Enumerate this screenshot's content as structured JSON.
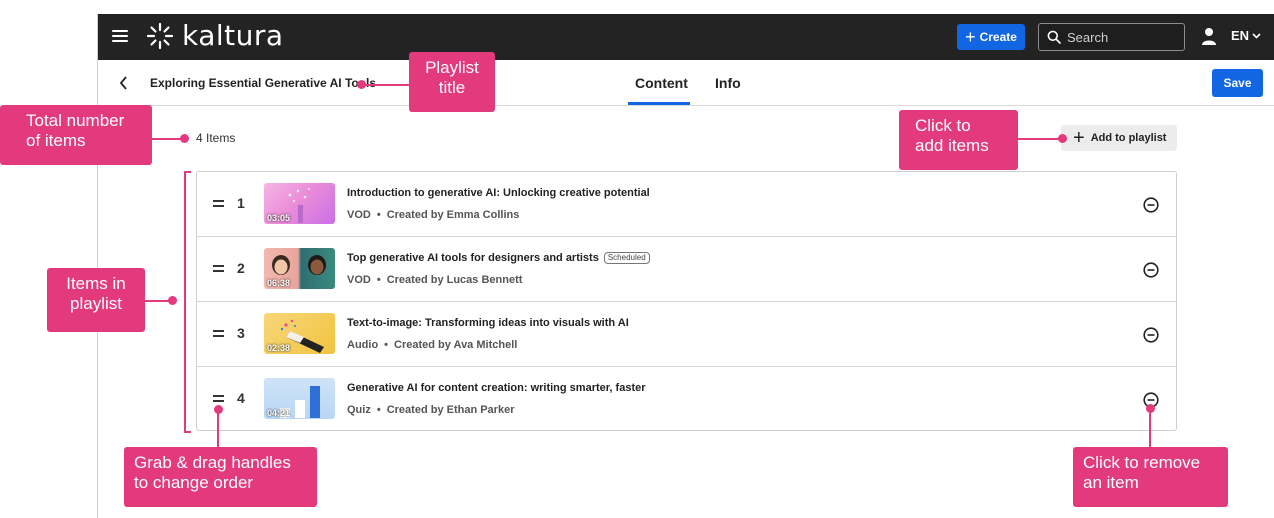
{
  "app": {
    "logo_text": "kaltura",
    "create_label": "Create",
    "search_placeholder": "Search",
    "language": "EN"
  },
  "header": {
    "playlist_title": "Exploring Essential Generative AI Tools",
    "tabs": [
      {
        "label": "Content",
        "active": true
      },
      {
        "label": "Info",
        "active": false
      }
    ],
    "save_label": "Save"
  },
  "content": {
    "items_count": "4 Items",
    "add_label": "Add to playlist",
    "items": [
      {
        "number": "1",
        "duration": "03:05",
        "title": "Introduction to generative AI: Unlocking creative potential",
        "badge": "",
        "type": "VOD",
        "creator": "Created by Emma Collins"
      },
      {
        "number": "2",
        "duration": "06:38",
        "title": "Top generative AI tools for designers and artists",
        "badge": "Scheduled",
        "type": "VOD",
        "creator": "Created by Lucas Bennett"
      },
      {
        "number": "3",
        "duration": "02:38",
        "title": "Text-to-image: Transforming ideas into visuals with AI",
        "badge": "",
        "type": "Audio",
        "creator": "Created by Ava Mitchell"
      },
      {
        "number": "4",
        "duration": "04:21",
        "title": "Generative AI for content creation: writing smarter, faster",
        "badge": "",
        "type": "Quiz",
        "creator": "Created by Ethan Parker"
      }
    ]
  },
  "annotations": {
    "playlist_title": "Playlist\ntitle",
    "total_items": "Total number\nof items",
    "add_items": "Click to\nadd items",
    "items_in_playlist": "Items in\nplaylist",
    "drag_handles": "Grab & drag handles\nto change order",
    "remove_item": "Click to remove\nan item",
    "color": "#e33a7e"
  },
  "colors": {
    "topbar": "#232323",
    "accent": "#1266e3"
  }
}
